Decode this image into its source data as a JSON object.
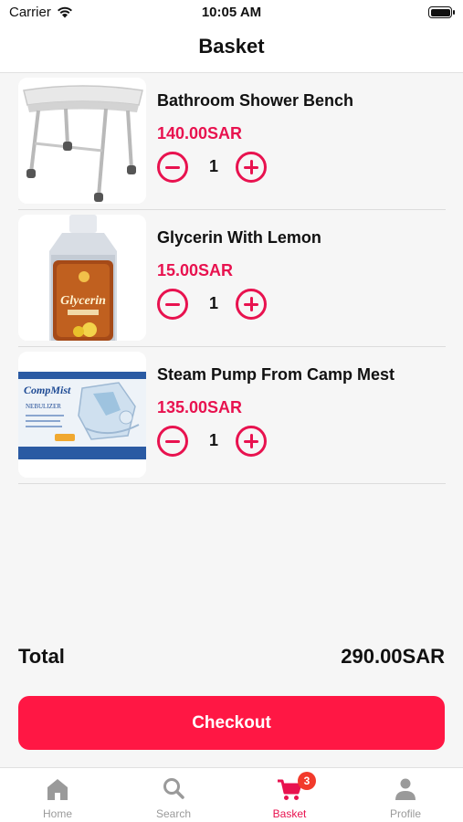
{
  "status_bar": {
    "carrier": "Carrier",
    "time": "10:05 AM"
  },
  "header": {
    "title": "Basket"
  },
  "items": [
    {
      "name": "Bathroom Shower Bench",
      "price": "140.00SAR",
      "quantity": "1",
      "image_icon": "shower-bench-image"
    },
    {
      "name": "Glycerin With Lemon",
      "price": "15.00SAR",
      "quantity": "1",
      "image_icon": "glycerin-bottle-image",
      "label_text": "Glycerin"
    },
    {
      "name": "Steam Pump From Camp Mest",
      "price": "135.00SAR",
      "quantity": "1",
      "image_icon": "nebulizer-box-image",
      "label_text": "CompMist",
      "label_sub": "NEBULIZER"
    }
  ],
  "summary": {
    "total_label": "Total",
    "total_value": "290.00SAR"
  },
  "checkout": {
    "label": "Checkout"
  },
  "tabs": [
    {
      "label": "Home",
      "icon": "home-icon"
    },
    {
      "label": "Search",
      "icon": "search-icon"
    },
    {
      "label": "Basket",
      "icon": "cart-icon",
      "badge": "3",
      "active": true
    },
    {
      "label": "Profile",
      "icon": "person-icon"
    }
  ],
  "colors": {
    "accent": "#e8124f",
    "checkout": "#ff1744",
    "badge": "#f23a2b",
    "inactive": "#9a9a9a"
  }
}
